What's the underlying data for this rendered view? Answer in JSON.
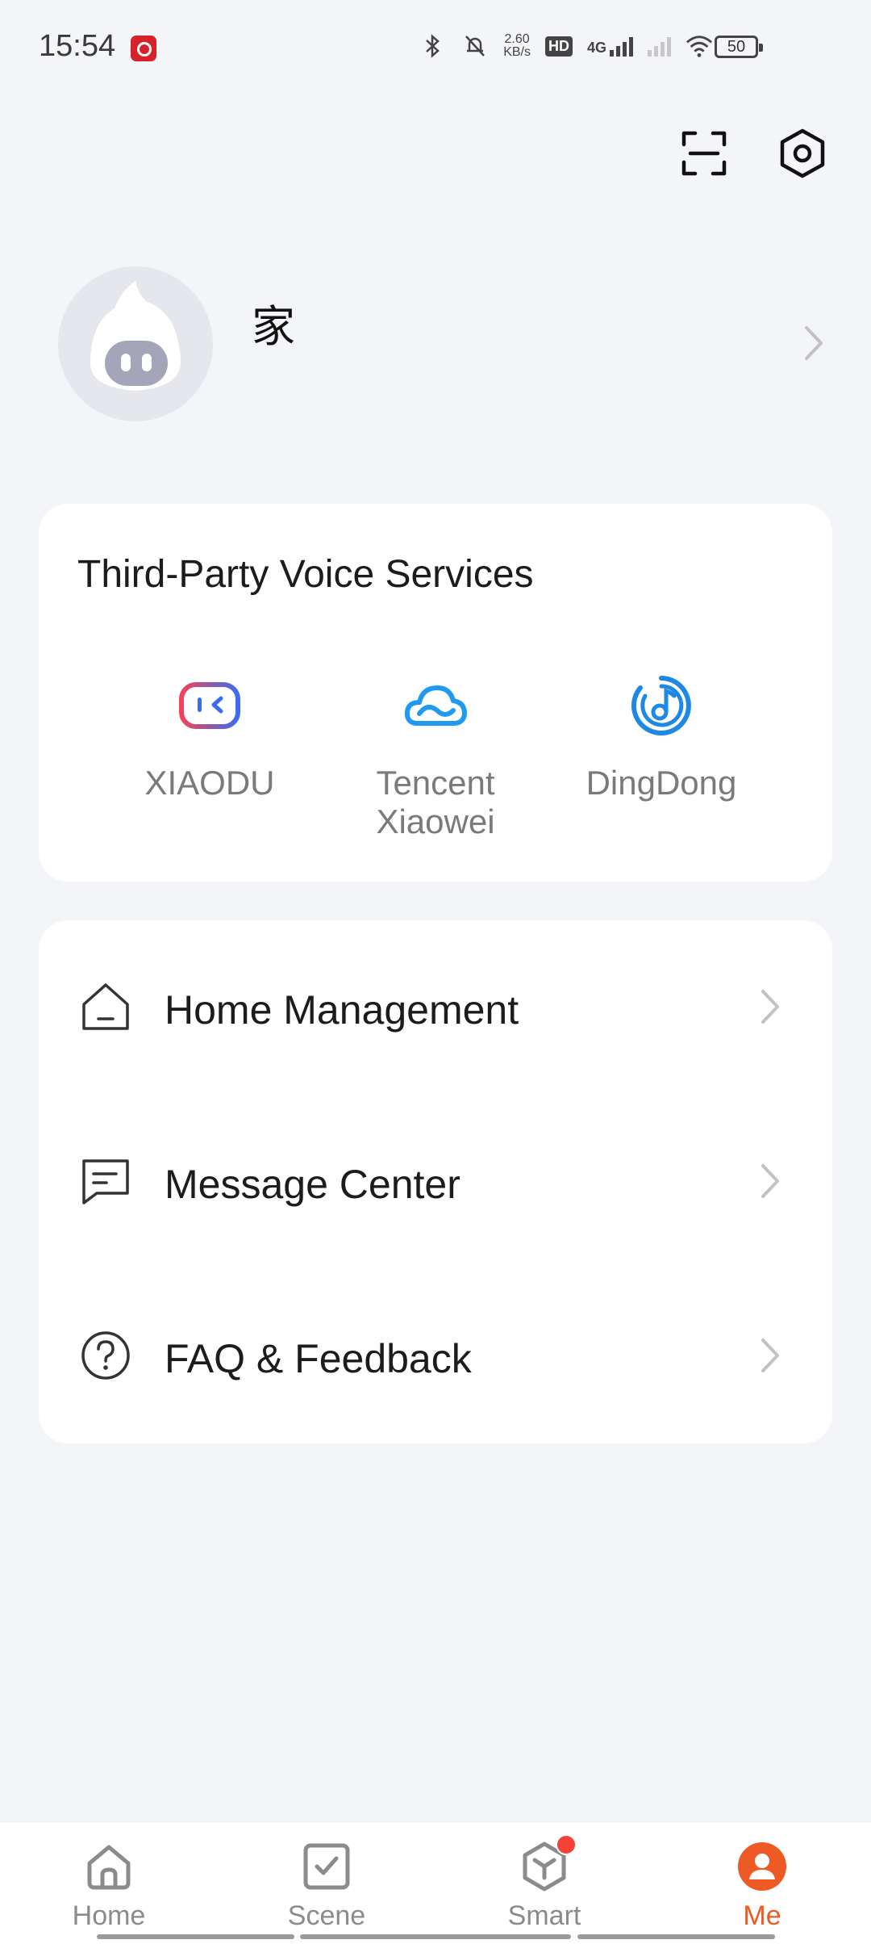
{
  "status_bar": {
    "time": "15:54",
    "net_speed_value": "2.60",
    "net_speed_unit": "KB/s",
    "hd_label": "HD",
    "network_type": "4G",
    "battery_level": "50"
  },
  "profile": {
    "home_name": "家"
  },
  "voice_services": {
    "title": "Third-Party Voice Services",
    "items": [
      {
        "label": "XIAODU",
        "icon": "xiaodu-icon",
        "color": "#e84a5f"
      },
      {
        "label": "Tencent Xiaowei",
        "icon": "cloud-icon",
        "color": "#1e9bf0"
      },
      {
        "label": "DingDong",
        "icon": "dingdong-icon",
        "color": "#1e88e5"
      }
    ]
  },
  "menu": {
    "items": [
      {
        "label": "Home Management",
        "icon": "house-icon"
      },
      {
        "label": "Message Center",
        "icon": "message-icon"
      },
      {
        "label": "FAQ & Feedback",
        "icon": "help-circle-icon"
      }
    ]
  },
  "bottom_nav": {
    "items": [
      {
        "label": "Home",
        "icon": "home-tab-icon",
        "active": false
      },
      {
        "label": "Scene",
        "icon": "scene-tab-icon",
        "active": false
      },
      {
        "label": "Smart",
        "icon": "smart-tab-icon",
        "active": false,
        "badge": true
      },
      {
        "label": "Me",
        "icon": "me-tab-icon",
        "active": true
      }
    ]
  },
  "colors": {
    "accent": "#ee5a24",
    "background": "#f4f5f9",
    "card": "#ffffff"
  }
}
